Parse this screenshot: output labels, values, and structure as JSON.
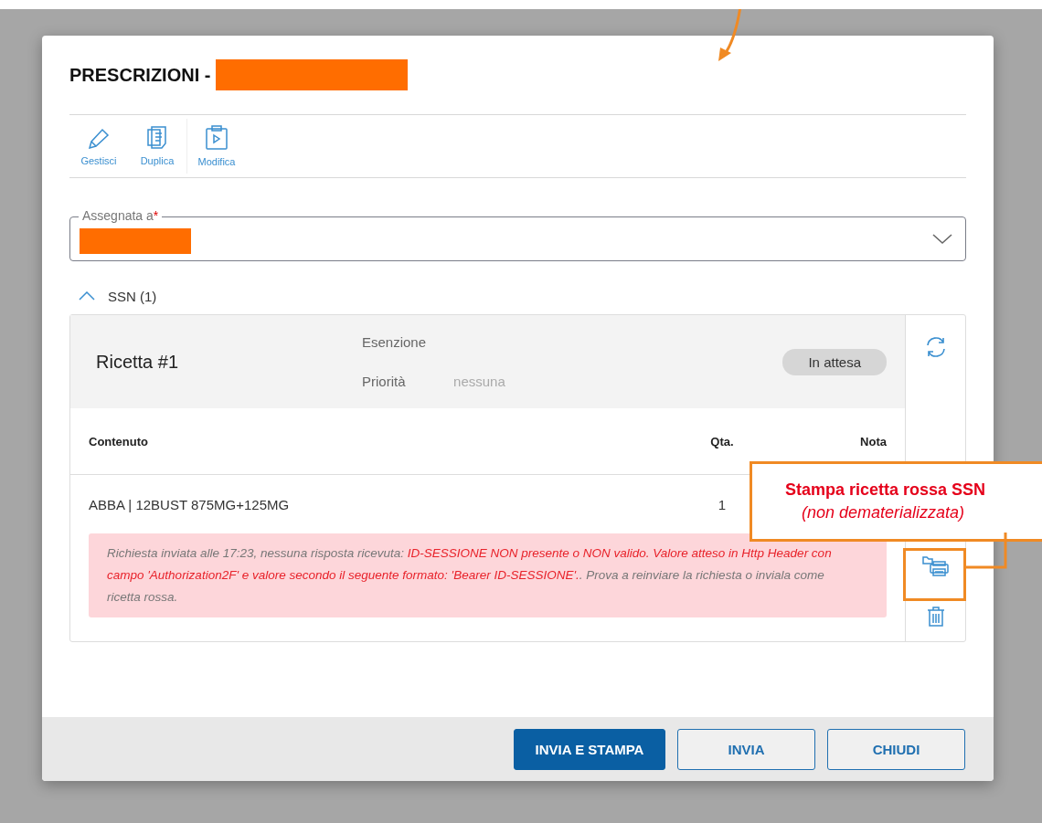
{
  "dialog": {
    "title": "PRESCRIZIONI -",
    "toolbar": [
      {
        "label": "Gestisci",
        "kind": "pencil"
      },
      {
        "label": "Duplica",
        "kind": "duplicate"
      },
      {
        "label": "Modifica",
        "kind": "clipboard"
      }
    ],
    "assigned_field": {
      "label": "Assegnata a",
      "required": true,
      "required_mark": "*"
    },
    "section": {
      "label": "SSN (1)",
      "expanded": true
    },
    "prescription": {
      "title": "Ricetta #1",
      "exemption_label": "Esenzione",
      "priority_label": "Priorità",
      "priority_value": "nessuna",
      "status": "In attesa",
      "columns": [
        "Contenuto",
        "Qta.",
        "Nota"
      ],
      "rows": [
        {
          "content": "ABBA | 12BUST 875MG+125MG",
          "qty": "1"
        }
      ],
      "message_parts": [
        {
          "text": "Richiesta inviata alle 17:23, nessuna risposta ricevuta: ",
          "kind": "normal"
        },
        {
          "text": "ID-SESSIONE NON presente o NON valido. Valore atteso in Http Header con campo 'Authorization2F' e valore secondo il seguente formato: 'Bearer ID-SESSIONE'.",
          "kind": "error"
        },
        {
          "text": ". Prova a reinviare la richiesta o inviala come ricetta rossa.",
          "kind": "normal"
        }
      ]
    },
    "buttons": [
      {
        "label": "INVIA E STAMPA",
        "kind": "primary"
      },
      {
        "label": "INVIA",
        "kind": "outline"
      },
      {
        "label": "CHIUDI",
        "kind": "outline"
      }
    ]
  },
  "annotation": {
    "title": "Stampa ricetta rossa SSN",
    "subtitle": "(non dematerializzata)"
  }
}
